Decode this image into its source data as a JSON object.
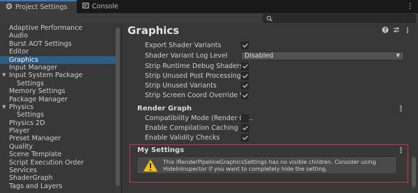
{
  "tabs": {
    "project_settings": "Project Settings",
    "console": "Console"
  },
  "search": {
    "placeholder": ""
  },
  "sidebar": {
    "items": [
      "Adaptive Performance",
      "Audio",
      "Burst AOT Settings",
      "Editor",
      "Graphics",
      "Input Manager",
      "Input System Package",
      "Settings",
      "Memory Settings",
      "Package Manager",
      "Physics",
      "Settings",
      "Physics 2D",
      "Player",
      "Preset Manager",
      "Quality",
      "Scene Template",
      "Script Execution Order",
      "Services",
      "ShaderGraph",
      "Tags and Layers"
    ],
    "selected": "Graphics"
  },
  "main": {
    "title": "Graphics",
    "shader_rows": {
      "export_shader_variants": "Export Shader Variants",
      "shader_variant_log_level": "Shader Variant Log Level",
      "log_level_value": "Disabled",
      "strip_runtime_debug": "Strip Runtime Debug Shaders",
      "strip_unused_post": "Strip Unused Post Processing ...",
      "strip_unused_variants": "Strip Unused Variants",
      "strip_screen_coord": "Strip Screen Coord Override V..."
    },
    "render_graph": {
      "heading": "Render Graph",
      "compatibility_mode": "Compatibility Mode (Render Gr...",
      "enable_compilation_caching": "Enable Compilation Caching",
      "enable_validity_checks": "Enable Validity Checks"
    },
    "my_settings": {
      "heading": "My Settings",
      "help_text": "This IRenderPipelineGraphicsSettings has no visible children. Consider using HideInInspector if you want to completely hide the setting."
    }
  },
  "colors": {
    "accent": "#3a79bb",
    "selection": "#2c5d87",
    "highlight_border": "#c8375a",
    "warning": "#f0c419"
  },
  "icons": {
    "project_settings_tab": "gear-icon",
    "console_tab": "console-icon",
    "search": "search-icon",
    "help": "help-icon",
    "preset": "sliders-icon",
    "menu": "kebab-icon",
    "warning": "warning-icon"
  }
}
